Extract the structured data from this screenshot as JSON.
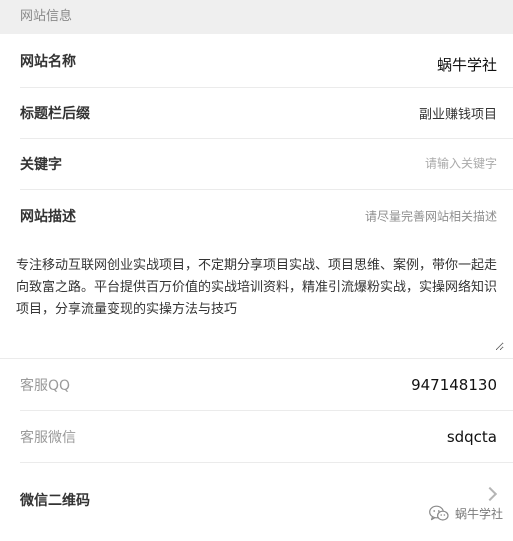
{
  "section": {
    "title": "网站信息"
  },
  "fields": {
    "site_name": {
      "label": "网站名称",
      "value": "蜗牛学社"
    },
    "title_suffix": {
      "label": "标题栏后缀",
      "value": "副业赚钱项目"
    },
    "keywords": {
      "label": "关键字",
      "placeholder": "请输入关键字"
    },
    "description": {
      "label": "网站描述",
      "hint": "请尽量完善网站相关描述",
      "value": "专注移动互联网创业实战项目，不定期分享项目实战、项目思维、案例，带你一起走向致富之路。平台提供百万价值的实战培训资料，精准引流爆粉实战，实操网络知识项目，分享流量变现的实操方法与技巧"
    },
    "service_qq": {
      "label": "客服QQ",
      "value": "947148130"
    },
    "service_wechat": {
      "label": "客服微信",
      "value": "sdqcta"
    },
    "wechat_qrcode": {
      "label": "微信二维码"
    }
  },
  "watermark": {
    "icon": "wechat-icon",
    "text": "蜗牛学社"
  }
}
